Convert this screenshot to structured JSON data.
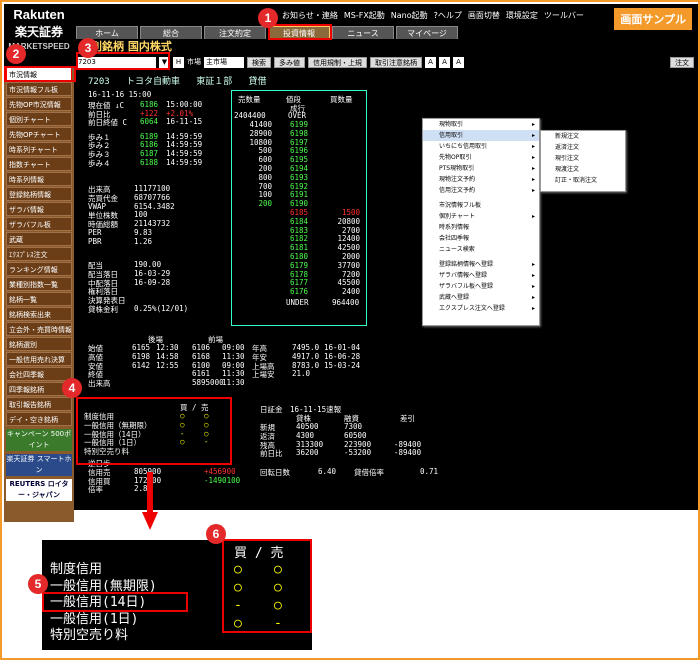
{
  "logo": {
    "brand": "Rakuten",
    "name": "楽天証券",
    "product": "MARKETSPEED"
  },
  "sample_label": "画面サンプル",
  "tools": [
    "お知らせ・連絡",
    "MS-FX起動",
    "Nano起動",
    "?ヘルプ",
    "画面切替",
    "環境設定",
    "ツールバー"
  ],
  "tabs": [
    "ホーム",
    "総合",
    "注文約定",
    "投資情報",
    "ニュース",
    "マイページ"
  ],
  "active_tab": "投資情報",
  "title": "個別銘柄  国内株式",
  "toolbar": {
    "stock_code": "7203",
    "market_label": "市場",
    "market_value": "主市場",
    "search_btn": "検索",
    "multi_btn": "多み値",
    "credit_btn": "信用規制・上規",
    "margin_btn": "取引注意銘柄",
    "font_a1": "A",
    "font_a2": "A",
    "font_a3": "A",
    "order_btn": "注文"
  },
  "sidebar": [
    "市況情報",
    "市況情報フル板",
    "先物OP市況情報",
    "個別チャート",
    "先物OPチャート",
    "時系列チャート",
    "指数チャート",
    "時系列情報",
    "登録銘柄情報",
    "ザラバ情報",
    "ザラバフル板",
    "武蔵",
    "ｴｸｽﾌﾟﾚｽ注文",
    "ランキング情報",
    "業種別指数一覧",
    "銘柄一覧",
    "銘柄検索出来",
    "立会外・売買時情報",
    "銘柄選別",
    "一般信用売れ決算",
    "会社四季報",
    "四季報銘柄",
    "取引報告銘柄",
    "デイ・空き銘柄"
  ],
  "sidebar_ads": [
    "キャンペーン 500ポイント",
    "楽天証券 スマートホン",
    "REUTERS ロイター・ジャパン"
  ],
  "stock": {
    "code": "7203",
    "name": "トヨタ自動車",
    "market": "東証１部",
    "type": "貸借",
    "datetime": "16-11-16 15:00"
  },
  "quote_rows": [
    {
      "label": "現在値 ↓C",
      "value": "6186",
      "time": "15:00:00"
    },
    {
      "label": "前日比",
      "value": "+122",
      "extra": "+2.01%"
    },
    {
      "label": "前日終値 C",
      "value": "6064",
      "time": "16-11-15"
    },
    {
      "label": "歩み１",
      "value": "6189",
      "time": "14:59:59"
    },
    {
      "label": "歩み２",
      "value": "6186",
      "time": "14:59:59"
    },
    {
      "label": "歩み３",
      "value": "6187",
      "time": "14:59:59"
    },
    {
      "label": "歩み４",
      "value": "6188",
      "time": "14:59:59"
    }
  ],
  "stats": [
    {
      "label": "出来高",
      "value": "11177100"
    },
    {
      "label": "売買代金",
      "value": "68707766"
    },
    {
      "label": "VWAP",
      "value": "6154.3482"
    },
    {
      "label": "単位株数",
      "value": "100"
    },
    {
      "label": "時価総額",
      "value": "21143732"
    },
    {
      "label": "PER",
      "value": "9.83"
    },
    {
      "label": "PBR",
      "value": "1.26"
    }
  ],
  "dividend": [
    {
      "label": "配当",
      "value": "190.00"
    },
    {
      "label": "配当落日",
      "value": "16-03-29"
    },
    {
      "label": "中配落日",
      "value": "16-09-28"
    },
    {
      "label": "権利落日",
      "value": ""
    },
    {
      "label": "決算発表日",
      "value": ""
    },
    {
      "label": "貸株金利",
      "value": "0.25%(12/01)"
    }
  ],
  "board": {
    "headers": [
      "売数量",
      "値段",
      "買数量"
    ],
    "over": {
      "label": "成行",
      "qty": "2404400",
      "price": "OVER"
    },
    "asks": [
      [
        "41400",
        "6199"
      ],
      [
        "28900",
        "6198"
      ],
      [
        "10800",
        "6197"
      ],
      [
        "500",
        "6196"
      ],
      [
        "600",
        "6195"
      ],
      [
        "200",
        "6194"
      ],
      [
        "800",
        "6193"
      ],
      [
        "700",
        "6192"
      ],
      [
        "100",
        "6191"
      ],
      [
        "200",
        "6190"
      ]
    ],
    "current": "6186",
    "bids": [
      [
        "6185",
        "1500"
      ],
      [
        "6184",
        "20800"
      ],
      [
        "6183",
        "2700"
      ],
      [
        "6182",
        "12400"
      ],
      [
        "6181",
        "42500"
      ],
      [
        "6180",
        "2000"
      ],
      [
        "6179",
        "37700"
      ],
      [
        "6178",
        "7200"
      ],
      [
        "6177",
        "45500"
      ],
      [
        "6176",
        "2400"
      ]
    ],
    "under": {
      "price": "UNDER",
      "qty": "964400"
    }
  },
  "sessions": {
    "headers": [
      "後場",
      "前場"
    ],
    "rows": [
      [
        "始値",
        "6165",
        "12:30",
        "6106",
        "09:00",
        "年高",
        "7495.0",
        "16-01-04"
      ],
      [
        "高値",
        "6198",
        "14:58",
        "6168",
        "11:30",
        "年安",
        "4917.0",
        "16-06-28"
      ],
      [
        "安値",
        "6142",
        "12:55",
        "6100",
        "09:00",
        "上場高",
        "8783.0",
        "15-03-24"
      ],
      [
        "終値",
        "",
        "",
        "6161",
        "11:30",
        "上場安",
        "21.0",
        ""
      ],
      [
        "出来高",
        "",
        "",
        "5895000",
        "11:30",
        "",
        "",
        ""
      ]
    ]
  },
  "credit_table": {
    "header": [
      "買",
      "/",
      "売"
    ],
    "rows": [
      {
        "label": "制度信用",
        "buy": "○",
        "sell": "○"
      },
      {
        "label": "一般信用（無期限）",
        "buy": "○",
        "sell": "○"
      },
      {
        "label": "一般信用（14日）",
        "buy": "-",
        "sell": "○"
      },
      {
        "label": "一般信用（1日）",
        "buy": "○",
        "sell": "-"
      },
      {
        "label": "特別空売り料",
        "buy": "",
        "sell": ""
      }
    ]
  },
  "lower_left": [
    {
      "label": "逆日歩",
      "value": ""
    },
    {
      "label": "信用売",
      "value": "805900",
      "extra": "+456900"
    },
    {
      "label": "信用買",
      "value": "172600",
      "extra": "-1490100"
    },
    {
      "label": "倍率",
      "value": "2.86"
    }
  ],
  "margin_stats": {
    "title": "日証金　16-11-15速報",
    "headers": [
      "貸株",
      "融資",
      "差引"
    ],
    "rows": [
      [
        "新規",
        "40500",
        "7300",
        ""
      ],
      [
        "返済",
        "4300",
        "60500",
        ""
      ],
      [
        "残高",
        "313300",
        "223900",
        "-89400"
      ],
      [
        "前日比",
        "36200",
        "-53200",
        "-89400"
      ]
    ],
    "turnover_label": "回転日数",
    "turnover": "6.40",
    "ratio_label": "貸借倍率",
    "ratio": "0.71"
  },
  "context_menu": [
    "現物取引",
    "信用取引",
    "いちにち信用取引",
    "先物OP取引",
    "PTS現物取引",
    "現物注文予約",
    "信用注文予約",
    "",
    "市況情報フル板",
    "個別チャート",
    "時系列情報",
    "会社四季報",
    "ニュース検索",
    "",
    "登録銘柄情報へ登録",
    "ザラバ情報へ登録",
    "ザラバフル板へ登録",
    "武蔵へ登録",
    "エクスプレス注文へ登録"
  ],
  "submenu": [
    "新規注文",
    "返済注文",
    "現引注文",
    "現渡注文",
    "訂正・取消注文"
  ],
  "badges": [
    "1",
    "2",
    "3",
    "4",
    "5",
    "6"
  ],
  "zoom": {
    "left": [
      "制度信用",
      "一般信用(無期限)",
      "一般信用(14日)",
      "一般信用(1日)",
      "特別空売り料"
    ],
    "header": "買 / 売",
    "right": [
      [
        "○",
        "○"
      ],
      [
        "○",
        "○"
      ],
      [
        "-",
        "○"
      ],
      [
        "○",
        "-"
      ]
    ]
  }
}
